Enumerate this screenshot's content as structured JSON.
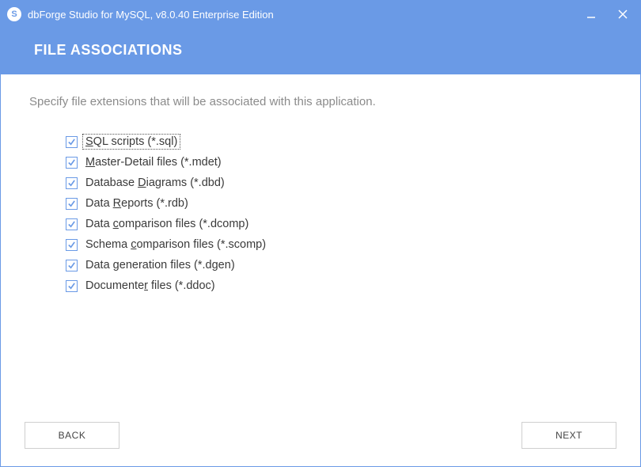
{
  "colors": {
    "accent": "#6a9ae6",
    "text": "#3a3a3a",
    "muted": "#8b8b8b"
  },
  "titlebar": {
    "app_icon_glyph": "S",
    "title": "dbForge Studio for MySQL, v8.0.40 Enterprise Edition"
  },
  "header": {
    "heading": "FILE ASSOCIATIONS"
  },
  "content": {
    "instruction": "Specify file extensions that will be associated with this application.",
    "items": [
      {
        "checked": true,
        "focused": true,
        "pre": "",
        "mnemonic": "S",
        "post": "QL scripts (*.sql)"
      },
      {
        "checked": true,
        "focused": false,
        "pre": "",
        "mnemonic": "M",
        "post": "aster-Detail files (*.mdet)"
      },
      {
        "checked": true,
        "focused": false,
        "pre": "Database ",
        "mnemonic": "D",
        "post": "iagrams (*.dbd)"
      },
      {
        "checked": true,
        "focused": false,
        "pre": "Data ",
        "mnemonic": "R",
        "post": "eports (*.rdb)"
      },
      {
        "checked": true,
        "focused": false,
        "pre": "Data ",
        "mnemonic": "c",
        "post": "omparison files (*.dcomp)"
      },
      {
        "checked": true,
        "focused": false,
        "pre": "Schema ",
        "mnemonic": "c",
        "post": "omparison files (*.scomp)"
      },
      {
        "checked": true,
        "focused": false,
        "pre": "Data ",
        "mnemonic": "g",
        "post": "eneration files (*.dgen)"
      },
      {
        "checked": true,
        "focused": false,
        "pre": "Documente",
        "mnemonic": "r",
        "post": " files (*.ddoc)"
      }
    ]
  },
  "footer": {
    "back_label": "BACK",
    "next_label": "NEXT"
  }
}
